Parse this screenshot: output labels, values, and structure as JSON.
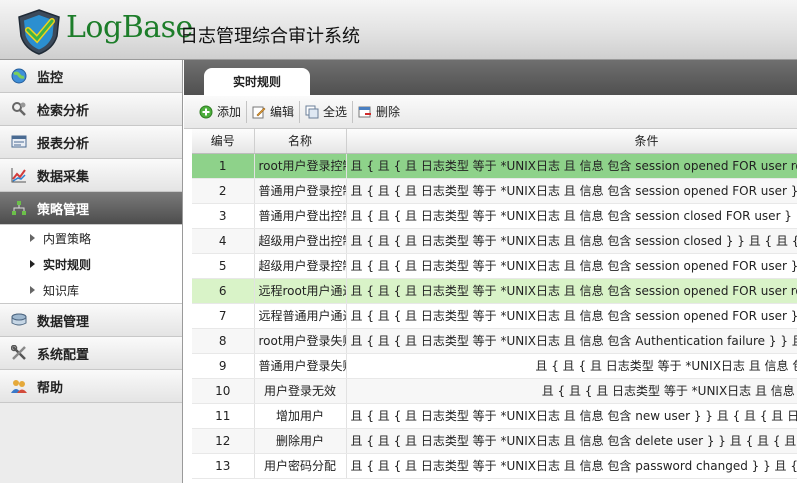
{
  "header": {
    "logo_text": "LogBase",
    "subtitle": "日志管理综合审计系统"
  },
  "sidebar": {
    "items": [
      {
        "label": "监控",
        "icon": "globe-icon"
      },
      {
        "label": "检索分析",
        "icon": "magnifier-gear-icon"
      },
      {
        "label": "报表分析",
        "icon": "report-icon"
      },
      {
        "label": "数据采集",
        "icon": "chart-line-icon"
      },
      {
        "label": "策略管理",
        "icon": "network-icon",
        "active": true
      },
      {
        "label": "数据管理",
        "icon": "storage-icon"
      },
      {
        "label": "系统配置",
        "icon": "tools-icon"
      },
      {
        "label": "帮助",
        "icon": "help-users-icon"
      }
    ],
    "sub_items": [
      {
        "label": "内置策略"
      },
      {
        "label": "实时规则",
        "active": true
      },
      {
        "label": "知识库"
      }
    ]
  },
  "main": {
    "tab_label": "实时规则",
    "toolbar": {
      "add": "添加",
      "edit": "编辑",
      "select_all": "全选",
      "delete": "删除"
    },
    "columns": {
      "num": "编号",
      "name": "名称",
      "cond": "条件"
    },
    "rows": [
      {
        "num": "1",
        "name": "root用户登录控制",
        "cond": "且 { 且 { 且 日志类型 等于 *UNIX日志 且 信息 包含 session opened FOR user root } } 且"
      },
      {
        "num": "2",
        "name": "普通用户登录控制",
        "cond": "且 { 且 { 且 日志类型 等于 *UNIX日志 且 信息 包含 session opened FOR user } } 且 { 且"
      },
      {
        "num": "3",
        "name": "普通用户登出控制",
        "cond": "且 { 且 { 且 日志类型 等于 *UNIX日志 且 信息 包含 session closed FOR user } } 且 { 且"
      },
      {
        "num": "4",
        "name": "超级用户登出控制",
        "cond": "且 { 且 { 且 日志类型 等于 *UNIX日志 且 信息 包含 session closed } } 且 { 且 { 且 日志"
      },
      {
        "num": "5",
        "name": "超级用户登录控制",
        "cond": "且 { 且 { 且 日志类型 等于 *UNIX日志 且 信息 包含 session opened FOR user } } 且 { 且"
      },
      {
        "num": "6",
        "name": "远程root用户通过",
        "cond": "且 { 且 { 且 日志类型 等于 *UNIX日志 且 信息 包含 session opened FOR user root } } 且"
      },
      {
        "num": "7",
        "name": "远程普通用户通过",
        "cond": "且 { 且 { 且 日志类型 等于 *UNIX日志 且 信息 包含 session opened FOR user } } 且 { 且"
      },
      {
        "num": "8",
        "name": "root用户登录失败",
        "cond": "且 { 且 { 且 日志类型 等于 *UNIX日志 且 信息 包含 Authentication failure } } 且 { 且"
      },
      {
        "num": "9",
        "name": "普通用户登录失败",
        "cond": "且 { 且 { 且 日志类型 等于 *UNIX日志 且 信息 包含 FAILED LOGIN",
        "center": true
      },
      {
        "num": "10",
        "name": "用户登录无效",
        "cond": "且 { 且 { 且 日志类型 等于 *UNIX日志 且 信息 包含 Invalid user",
        "center": true
      },
      {
        "num": "11",
        "name": "增加用户",
        "cond": "且 { 且 { 且 日志类型 等于 *UNIX日志 且 信息 包含 new user } } 且 { 且 { 且 日志类型 等"
      },
      {
        "num": "12",
        "name": "删除用户",
        "cond": "且 { 且 { 且 日志类型 等于 *UNIX日志 且 信息 包含 delete user } } 且 { 且 { 且 日志类型"
      },
      {
        "num": "13",
        "name": "用户密码分配",
        "cond": "且 { 且 { 且 日志类型 等于 *UNIX日志 且 信息 包含 password changed } } 且 { 且 { 且"
      }
    ]
  },
  "colors": {
    "selected_row": "#8ed28a",
    "highlight_row": "#d9f3c8",
    "logo_green": "#1d7d2a"
  }
}
